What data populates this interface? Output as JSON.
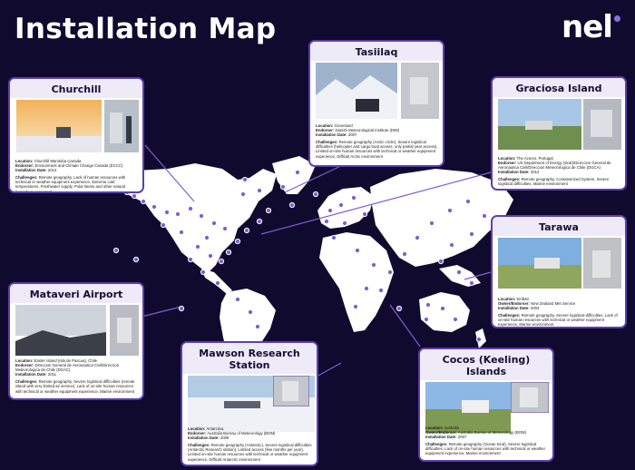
{
  "title": "Installation Map",
  "logo": "nel",
  "colors": {
    "background": "#0f0a2e",
    "land": "#ffffff",
    "marker": "#7d5fd0",
    "accent": "#5b3fb0"
  },
  "cards": [
    {
      "name": "Churchill",
      "location": "Churchill Manitoba Canada",
      "endorser": "Environment and Climate Change Canada (ECCC)",
      "installation_date": "2014",
      "challenges": "Remote geography, Lack of human resources with technical or weather equipment experience, Extreme cold temperatures, Freshwater supply, Polar Bears and other natural hazards to personnel"
    },
    {
      "name": "Tasiilaq",
      "location": "Greenland",
      "endorser": "Danish Meteorological Institute (DMI)",
      "installation_date": "2007",
      "challenges": "Remote geography (Arctic circle), Severe logistical difficulties (helicopter and cargo boat access, only partial year access), Limited on-site human resources with technical or weather equipment experience, Difficult Arctic environment"
    },
    {
      "name": "Graciosa Island",
      "location": "The Azores, Portugal",
      "endorser": "US Department of Energy (DoE)/Direccion General de Aeronautica Civil/Direccion Meteorologica de Chile (DGCA)",
      "installation_date": "2012",
      "challenges": "Remote geography, Containerized System, Severe logistical difficulties, Marine environment"
    },
    {
      "name": "Tarawa",
      "location": "Kiribati",
      "endorser": "New Zealand Met Service",
      "endorser_label": "Owner/Endorser:",
      "installation_date": "2003",
      "challenges": "Remote geography, Severe logistical difficulties, Lack of on-site human resources with technical or weather equipment experience, Marine environment"
    },
    {
      "name": "Mataveri Airport",
      "location": "Easter Island (Isla de Pascua), Chile",
      "endorser": "Direccion General de Aeronautica Civil/Direccion Meteorologica de Chile (DGAC)",
      "installation_date": "2011",
      "challenges": "Remote geography, Severe logistical difficulties (remote island with very limited air service), Lack of on-site human resources with technical or weather equipment experience, Marine environment"
    },
    {
      "name": "Mawson Research Station",
      "location": "Antarctica",
      "endorser": "Australia Bureau of Meteorology (BOM)",
      "installation_date": "2009",
      "challenges": "Remote geography (Antarctic), Severe logistical difficulties (Antarctic Research station), Limited access (few months per year), Limited on-site human resources with technical or weather equipment experience, Difficult Antarctic environment"
    },
    {
      "name": "Cocos (Keeling) Islands",
      "location": "Australia",
      "endorser": "Australia Bureau of Meteorology (BOM)",
      "endorser_label": "Owner/Endorser:",
      "installation_date": "2007",
      "challenges": "Remote geography (Ocean Kind), Severe logistical difficulties, Lack of on-site human resources with technical or weather equipment experience, Marine environment"
    }
  ],
  "labels": {
    "location": "Location:",
    "endorser": "Endorser:",
    "installation_date": "Installation Date:",
    "challenges": "Challenges:"
  }
}
